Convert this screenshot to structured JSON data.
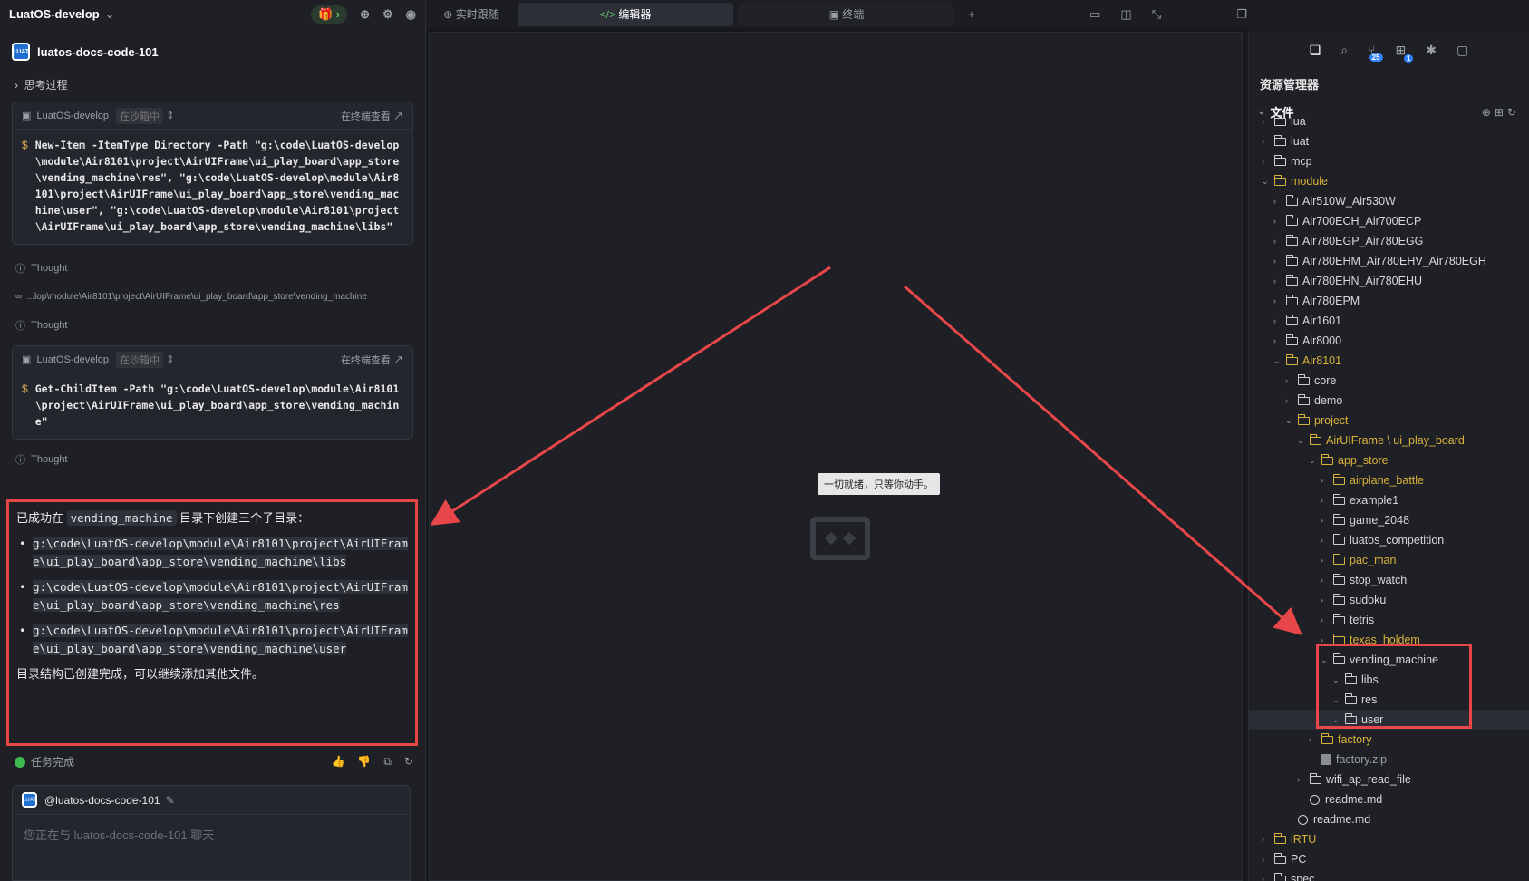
{
  "left": {
    "workspace": "LuatOS-develop",
    "agent_name": "luatos-docs-code-101",
    "thinking_label": "思考过程",
    "terminal1": {
      "title": "LuatOS-develop",
      "sandbox": "在沙箱中",
      "open_label": "在终端查看",
      "command": "New-Item -ItemType Directory -Path \"g:\\code\\LuatOS-develop\\module\\Air8101\\project\\AirUIFrame\\ui_play_board\\app_store\\vending_machine\\res\", \"g:\\code\\LuatOS-develop\\module\\Air8101\\project\\AirUIFrame\\ui_play_board\\app_store\\vending_machine\\user\", \"g:\\code\\LuatOS-develop\\module\\Air8101\\project\\AirUIFrame\\ui_play_board\\app_store\\vending_machine\\libs\""
    },
    "thought1": "Thought",
    "path_line": "...lop\\module\\Air8101\\project\\AirUIFrame\\ui_play_board\\app_store\\vending_machine",
    "thought2": "Thought",
    "terminal2": {
      "title": "LuatOS-develop",
      "sandbox": "在沙箱中",
      "open_label": "在终端查看",
      "command": "Get-ChildItem -Path \"g:\\code\\LuatOS-develop\\module\\Air8101\\project\\AirUIFrame\\ui_play_board\\app_store\\vending_machine\""
    },
    "thought3": "Thought",
    "reply": {
      "prefix": "已成功在",
      "code": "vending_machine",
      "suffix": "目录下创建三个子目录：",
      "items": [
        "g:\\code\\LuatOS-develop\\module\\Air8101\\project\\AirUIFrame\\ui_play_board\\app_store\\vending_machine\\libs",
        "g:\\code\\LuatOS-develop\\module\\Air8101\\project\\AirUIFrame\\ui_play_board\\app_store\\vending_machine\\res",
        "g:\\code\\LuatOS-develop\\module\\Air8101\\project\\AirUIFrame\\ui_play_board\\app_store\\vending_machine\\user"
      ],
      "closing": "目录结构已创建完成，可以继续添加其他文件。"
    },
    "done_label": "任务完成",
    "input_agent": "@luatos-docs-code-101",
    "input_placeholder": "您正在与 luatos-docs-code-101 聊天"
  },
  "tabs": {
    "follow": "实时跟随",
    "editor": "编辑器",
    "terminal": "终端",
    "add": "+"
  },
  "editor": {
    "tooltip": "一切就绪，只等你动手。"
  },
  "explorer": {
    "title": "资源管理器",
    "section": "文件",
    "scm_badge": "25",
    "ext_badge": "1",
    "rows": [
      {
        "label": "lua",
        "depth": 0,
        "type": "folder",
        "open": false,
        "color": "n"
      },
      {
        "label": "luat",
        "depth": 0,
        "type": "folder",
        "open": false,
        "color": "n"
      },
      {
        "label": "mcp",
        "depth": 0,
        "type": "folder",
        "open": false,
        "color": "n"
      },
      {
        "label": "module",
        "depth": 0,
        "type": "folder",
        "open": true,
        "color": "y"
      },
      {
        "label": "Air510W_Air530W",
        "depth": 1,
        "type": "folder",
        "open": false,
        "color": "n"
      },
      {
        "label": "Air700ECH_Air700ECP",
        "depth": 1,
        "type": "folder",
        "open": false,
        "color": "n"
      },
      {
        "label": "Air780EGP_Air780EGG",
        "depth": 1,
        "type": "folder",
        "open": false,
        "color": "n"
      },
      {
        "label": "Air780EHM_Air780EHV_Air780EGH",
        "depth": 1,
        "type": "folder",
        "open": false,
        "color": "n"
      },
      {
        "label": "Air780EHN_Air780EHU",
        "depth": 1,
        "type": "folder",
        "open": false,
        "color": "n"
      },
      {
        "label": "Air780EPM",
        "depth": 1,
        "type": "folder",
        "open": false,
        "color": "n"
      },
      {
        "label": "Air1601",
        "depth": 1,
        "type": "folder",
        "open": false,
        "color": "n"
      },
      {
        "label": "Air8000",
        "depth": 1,
        "type": "folder",
        "open": false,
        "color": "n"
      },
      {
        "label": "Air8101",
        "depth": 1,
        "type": "folder",
        "open": true,
        "color": "y"
      },
      {
        "label": "core",
        "depth": 2,
        "type": "folder",
        "open": false,
        "color": "n"
      },
      {
        "label": "demo",
        "depth": 2,
        "type": "folder",
        "open": false,
        "color": "n"
      },
      {
        "label": "project",
        "depth": 2,
        "type": "folder",
        "open": true,
        "color": "y"
      },
      {
        "label": "AirUIFrame \\ ui_play_board",
        "depth": 3,
        "type": "folder",
        "open": true,
        "color": "y"
      },
      {
        "label": "app_store",
        "depth": 4,
        "type": "folder",
        "open": true,
        "color": "y"
      },
      {
        "label": "airplane_battle",
        "depth": 5,
        "type": "folder",
        "open": false,
        "color": "y"
      },
      {
        "label": "example1",
        "depth": 5,
        "type": "folder",
        "open": false,
        "color": "n"
      },
      {
        "label": "game_2048",
        "depth": 5,
        "type": "folder",
        "open": false,
        "color": "n"
      },
      {
        "label": "luatos_competition",
        "depth": 5,
        "type": "folder",
        "open": false,
        "color": "n"
      },
      {
        "label": "pac_man",
        "depth": 5,
        "type": "folder",
        "open": false,
        "color": "y"
      },
      {
        "label": "stop_watch",
        "depth": 5,
        "type": "folder",
        "open": false,
        "color": "n"
      },
      {
        "label": "sudoku",
        "depth": 5,
        "type": "folder",
        "open": false,
        "color": "n"
      },
      {
        "label": "tetris",
        "depth": 5,
        "type": "folder",
        "open": false,
        "color": "n"
      },
      {
        "label": "texas_holdem",
        "depth": 5,
        "type": "folder",
        "open": false,
        "color": "y"
      },
      {
        "label": "vending_machine",
        "depth": 5,
        "type": "folder",
        "open": true,
        "color": "n"
      },
      {
        "label": "libs",
        "depth": 6,
        "type": "folder",
        "open": true,
        "color": "n"
      },
      {
        "label": "res",
        "depth": 6,
        "type": "folder",
        "open": true,
        "color": "n"
      },
      {
        "label": "user",
        "depth": 6,
        "type": "folder",
        "open": true,
        "color": "n",
        "selected": true
      },
      {
        "label": "factory",
        "depth": 4,
        "type": "folder",
        "open": false,
        "color": "y"
      },
      {
        "label": "factory.zip",
        "depth": 4,
        "type": "file",
        "color": "g"
      },
      {
        "label": "wifi_ap_read_file",
        "depth": 3,
        "type": "folder",
        "open": false,
        "color": "n"
      },
      {
        "label": "readme.md",
        "depth": 3,
        "type": "info",
        "color": "n"
      },
      {
        "label": "readme.md",
        "depth": 2,
        "type": "info",
        "color": "n"
      },
      {
        "label": "iRTU",
        "depth": 0,
        "type": "folder",
        "open": false,
        "color": "y"
      },
      {
        "label": "PC",
        "depth": 0,
        "type": "folder",
        "open": false,
        "color": "n"
      },
      {
        "label": "spec",
        "depth": 0,
        "type": "folder",
        "open": false,
        "color": "n"
      }
    ]
  },
  "colors": {
    "accent_red": "#e8474a",
    "folder_yellow": "#d9b23a",
    "success": "#3fb950"
  }
}
